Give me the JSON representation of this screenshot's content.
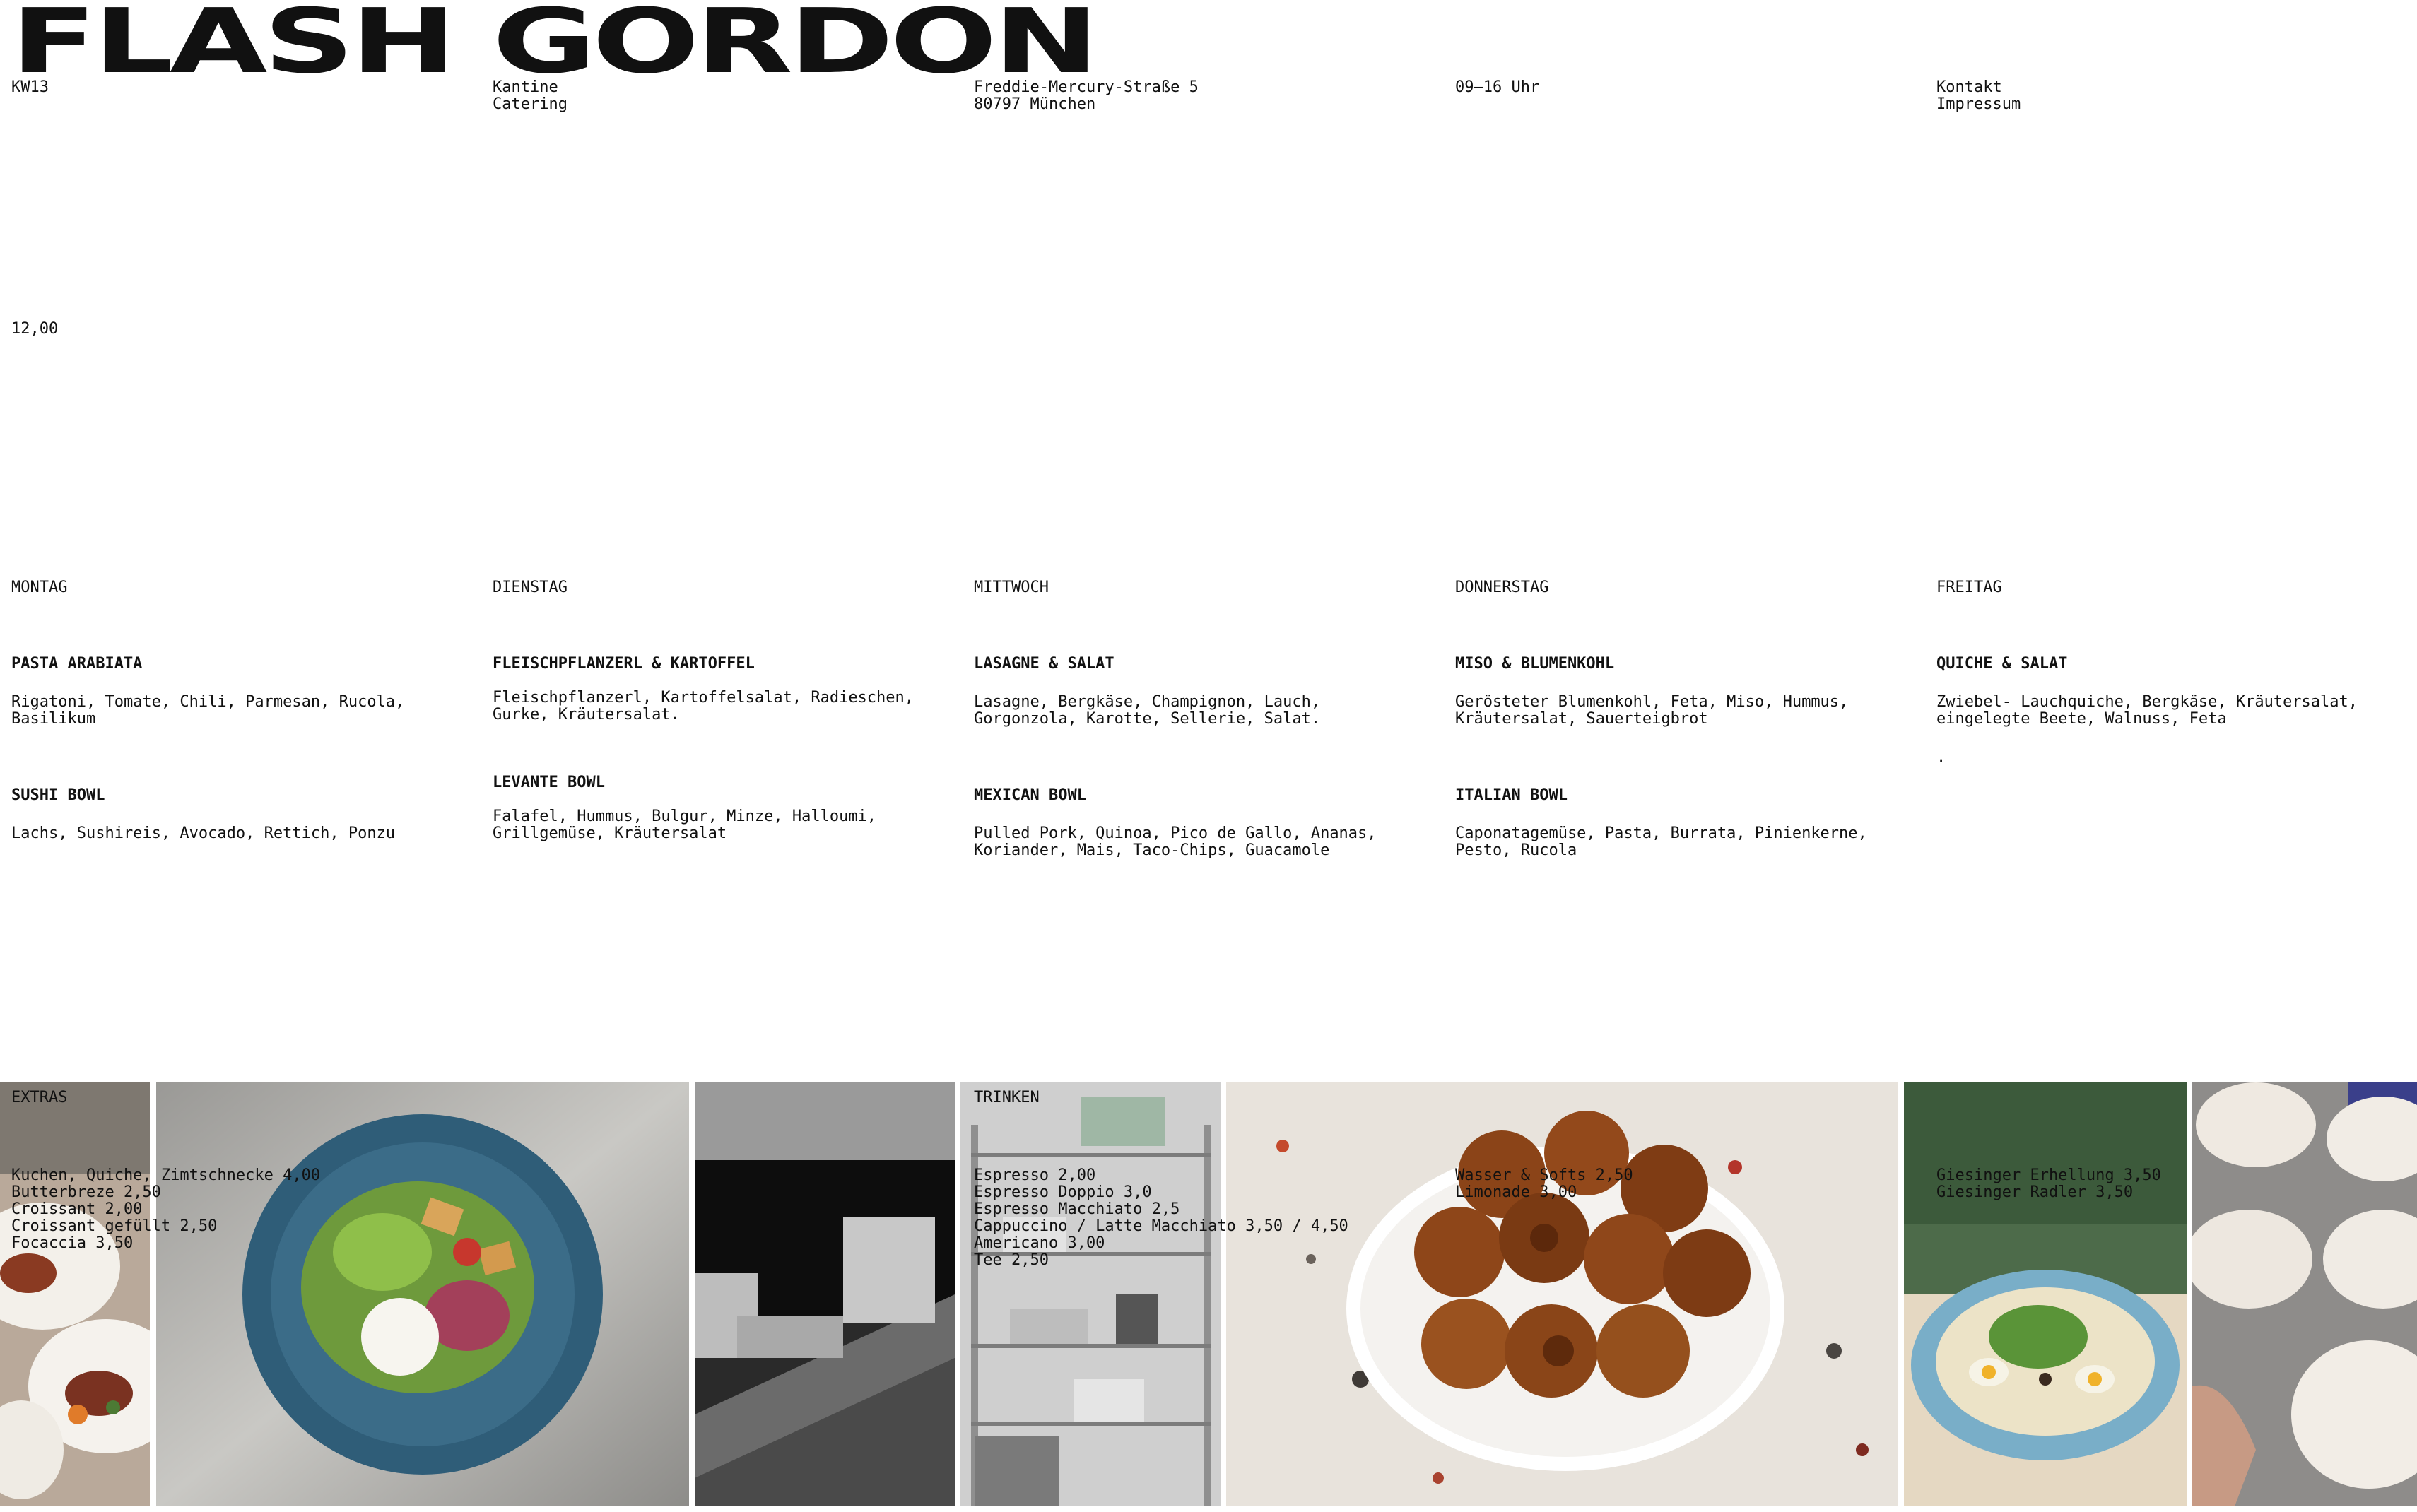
{
  "brand": {
    "logo": "FLASH GORDON"
  },
  "header": {
    "week": "KW13",
    "nav_kantine": "Kantine",
    "nav_catering": "Catering",
    "address_line1": "Freddie-Mercury-Straße 5",
    "address_line2": "80797 München",
    "hours": "09–16 Uhr",
    "link_kontakt": "Kontakt",
    "link_impressum": "Impressum"
  },
  "price": "12,00",
  "days": [
    {
      "name": "MONTAG",
      "dishes": [
        {
          "title": "PASTA ARABIATA",
          "desc": "Rigatoni, Tomate, Chili,  Parmesan, Rucola, Basilikum"
        },
        {
          "title": "SUSHI BOWL",
          "desc": "Lachs, Sushireis, Avocado, Rettich, Ponzu"
        }
      ]
    },
    {
      "name": "DIENSTAG",
      "dishes": [
        {
          "title": "FLEISCHPFLANZERL & KARTOFFEL",
          "desc": "Fleischpflanzerl, Kartoffelsalat, Radieschen, Gurke, Kräutersalat."
        },
        {
          "title": "LEVANTE BOWL",
          "desc": "Falafel, Hummus, Bulgur, Minze, Halloumi, Grillgemüse, Kräutersalat"
        }
      ]
    },
    {
      "name": "MITTWOCH",
      "dishes": [
        {
          "title": "LASAGNE & SALAT",
          "desc": "Lasagne, Bergkäse, Champignon, Lauch, Gorgonzola, Karotte, Sellerie, Salat."
        },
        {
          "title": "MEXICAN BOWL",
          "desc": "Pulled Pork, Quinoa, Pico de Gallo, Ananas, Koriander, Mais, Taco-Chips, Guacamole"
        }
      ]
    },
    {
      "name": "DONNERSTAG",
      "dishes": [
        {
          "title": "MISO & BLUMENKOHL",
          "desc": "Gerösteter Blumenkohl, Feta, Miso, Hummus, Kräutersalat, Sauerteigbrot"
        },
        {
          "title": "ITALIAN BOWL",
          "desc": "Caponatagemüse, Pasta,  Burrata, Pinienkerne, Pesto, Rucola"
        }
      ]
    },
    {
      "name": "FREITAG",
      "dishes": [
        {
          "title": "QUICHE & SALAT",
          "desc": "Zwiebel- Lauchquiche, Bergkäse, Kräutersalat, eingelegte Beete, Walnuss, Feta"
        }
      ],
      "note": "."
    }
  ],
  "extras": {
    "label": "EXTRAS",
    "items": [
      "Kuchen, Quiche, Zimtschnecke 4,00",
      "Butterbreze 2,50",
      "Croissant 2,00",
      "Croissant gefüllt 2,50",
      "Focaccia 3,50"
    ]
  },
  "drinks": {
    "label": "TRINKEN",
    "hot": [
      "Espresso 2,00",
      "Espresso Doppio 3,0",
      "Espresso Macchiato 2,5",
      "Cappuccino / Latte Macchiato 3,50 / 4,50",
      "Americano 3,00",
      "Tee 2,50"
    ],
    "cold": [
      "Wasser & Softs 2,50",
      "Limonade 3,00"
    ],
    "beer": [
      "Giesinger Erhellung 3,50",
      "Giesinger Radler 3,50"
    ]
  },
  "colors": {
    "text": "#111111",
    "background": "#ffffff"
  },
  "photos": [
    "plated-dishes-photo",
    "salad-bowl-photo",
    "kitchen-counter-photo",
    "storage-shelves-photo",
    "cinnamon-rolls-photo",
    "egg-bowl-photo",
    "dough-balls-photo"
  ]
}
